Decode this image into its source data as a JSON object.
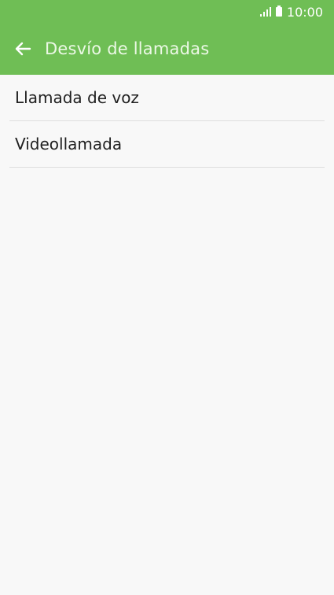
{
  "status_bar": {
    "time": "10:00",
    "icons": [
      "signal-icon",
      "battery-icon"
    ]
  },
  "app_bar": {
    "title": "Desvío de llamadas",
    "back_icon": "back-arrow-icon"
  },
  "list": {
    "items": [
      {
        "label": "Llamada de voz"
      },
      {
        "label": "Videollamada"
      }
    ]
  },
  "colors": {
    "accent": "#6fbe55",
    "background": "#f8f8f8",
    "divider": "#dedede",
    "text": "#202020"
  }
}
